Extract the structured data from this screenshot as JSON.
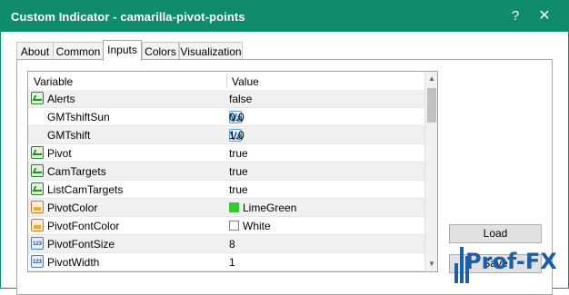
{
  "window": {
    "title": "Custom Indicator - camarilla-pivot-points",
    "help_glyph": "?",
    "close_glyph": "✕"
  },
  "tabs": [
    {
      "label": "About",
      "active": false
    },
    {
      "label": "Common",
      "active": false
    },
    {
      "label": "Inputs",
      "active": true
    },
    {
      "label": "Colors",
      "active": false
    },
    {
      "label": "Visualization",
      "active": false
    }
  ],
  "grid": {
    "headers": {
      "variable": "Variable",
      "value": "Value"
    },
    "rows": [
      {
        "variable": "Alerts",
        "value": "false",
        "icon": "bool-icon"
      },
      {
        "variable": "GMTshiftSun",
        "value": "0.0",
        "icon": "value-icon"
      },
      {
        "variable": "GMTshift",
        "value": "1.0",
        "icon": "value-icon"
      },
      {
        "variable": "Pivot",
        "value": "true",
        "icon": "bool-icon"
      },
      {
        "variable": "CamTargets",
        "value": "true",
        "icon": "bool-icon"
      },
      {
        "variable": "ListCamTargets",
        "value": "true",
        "icon": "bool-icon"
      },
      {
        "variable": "PivotColor",
        "value": "LimeGreen",
        "icon": "color-icon",
        "swatch": "#32cd32"
      },
      {
        "variable": "PivotFontColor",
        "value": "White",
        "icon": "color-icon",
        "swatch": "#ffffff"
      },
      {
        "variable": "PivotFontSize",
        "value": "8",
        "icon": "number-icon"
      },
      {
        "variable": "PivotWidth",
        "value": "1",
        "icon": "number-icon"
      }
    ],
    "icon_glyphs": {
      "value": "Va",
      "number": "123"
    }
  },
  "buttons": {
    "load": "Load",
    "save": "Save"
  },
  "watermark": {
    "text": "Prof-FX"
  },
  "colors": {
    "titlebar": "#0f8c6b",
    "logo": "#1a5fa8"
  }
}
